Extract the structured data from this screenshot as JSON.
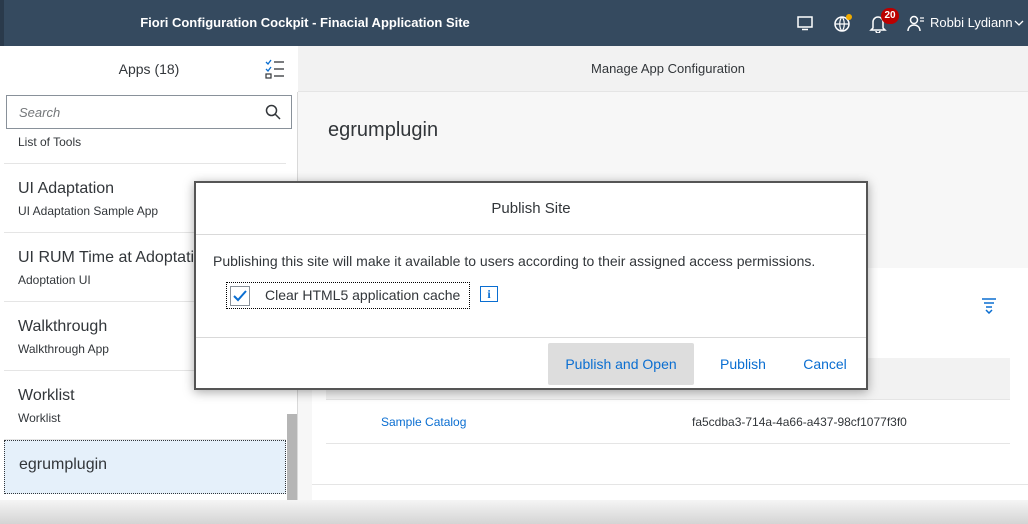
{
  "shell": {
    "title": "Fiori Configuration Cockpit - Finacial Application Site",
    "notification_count": "20",
    "user_name": "Robbi Lydiann",
    "icons": [
      "screen-icon",
      "globe-settings-icon",
      "bell-icon",
      "user-icon",
      "chevron-down-icon"
    ]
  },
  "left": {
    "title": "Apps (18)",
    "search_placeholder": "Search",
    "items": [
      {
        "title": "",
        "subtitle": "List of Tools"
      },
      {
        "title": "UI Adaptation",
        "subtitle": "UI Adaptation Sample App"
      },
      {
        "title": "UI RUM Time at Adoptation",
        "subtitle": "Adoptation UI"
      },
      {
        "title": "Walkthrough",
        "subtitle": "Walkthrough App"
      },
      {
        "title": "Worklist",
        "subtitle": "Worklist"
      },
      {
        "title": "egrumplugin",
        "subtitle": ""
      }
    ]
  },
  "right": {
    "header": "Manage App Configuration",
    "object_title": "egrumplugin",
    "table": {
      "rows": [
        {
          "name": "Sample Catalog",
          "id": "fa5cdba3-714a-4a66-a437-98cf1077f3f0"
        }
      ]
    }
  },
  "dialog": {
    "title": "Publish Site",
    "message": "Publishing this site will make it available to users according to their assigned access permissions.",
    "checkbox_label": "Clear HTML5 application cache",
    "checkbox_checked": true,
    "info_glyph": "i",
    "buttons": {
      "publish_open": "Publish and Open",
      "publish": "Publish",
      "cancel": "Cancel"
    }
  },
  "colors": {
    "shell": "#354a5f",
    "accent": "#0a6ed1",
    "badge": "#bb0000",
    "selected": "#e5f0fa"
  }
}
